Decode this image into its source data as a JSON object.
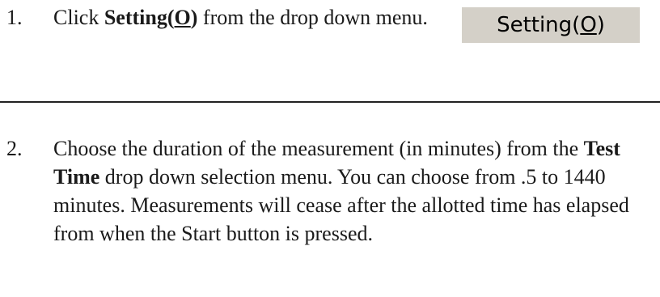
{
  "steps": [
    {
      "number": "1.",
      "text_before": "Click ",
      "bold_main": "Setting(",
      "bold_underlined": "O",
      "bold_close": ")",
      "text_after": " from the drop down menu.",
      "menu_thumbnail": {
        "label_main": "Setting(",
        "label_underlined": "O",
        "label_close": ")",
        "background": "#d4d0c8"
      }
    },
    {
      "number": "2.",
      "text_before": "Choose the duration of the measurement (in minutes) from the ",
      "bold": "Test Time",
      "text_after": " drop down selection menu. You can choose from .5 to 1440 minutes. Measurements will cease after the allotted time has elapsed from when the Start button is pressed."
    }
  ]
}
